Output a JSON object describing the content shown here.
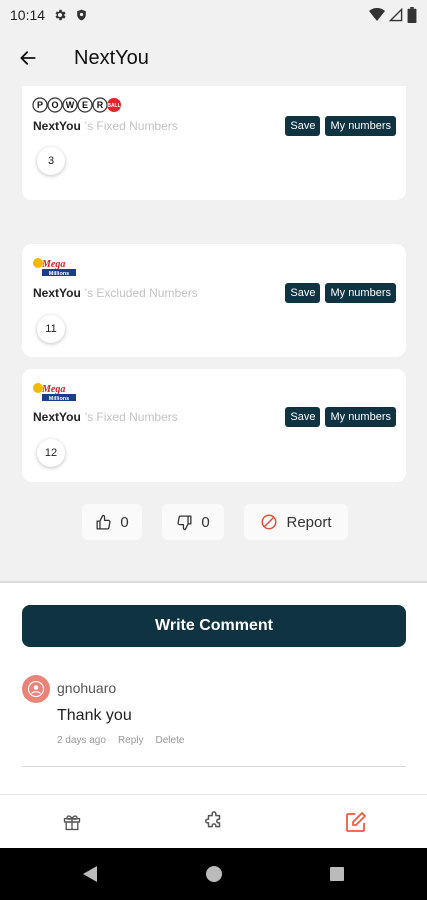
{
  "status_bar": {
    "time": "10:14"
  },
  "app_bar": {
    "title": "NextYou"
  },
  "cards": [
    {
      "logo": "powerball",
      "logo_text": "POWERBALL",
      "owner": "NextYou",
      "label": "'s Fixed Numbers",
      "save": "Save",
      "my_numbers": "My numbers",
      "ball": "3"
    },
    {
      "logo": "mega-millions",
      "logo_text": "Mega Millions",
      "owner": "NextYou",
      "label": "'s Excluded Numbers",
      "save": "Save",
      "my_numbers": "My numbers",
      "ball": "11"
    },
    {
      "logo": "mega-millions",
      "logo_text": "Mega Millions",
      "owner": "NextYou",
      "label": "'s Fixed Numbers",
      "save": "Save",
      "my_numbers": "My numbers",
      "ball": "12"
    }
  ],
  "reactions": {
    "likes": "0",
    "dislikes": "0",
    "report": "Report"
  },
  "comments": {
    "write_label": "Write Comment",
    "items": [
      {
        "user": "gnohuaro",
        "text": "Thank you",
        "time": "2 days ago",
        "reply": "Reply",
        "delete": "Delete"
      }
    ]
  },
  "bottom_nav": {
    "items": [
      {
        "icon": "gift-icon"
      },
      {
        "icon": "puzzle-icon"
      },
      {
        "icon": "edit-icon",
        "active": true
      }
    ]
  },
  "colors": {
    "accent": "#0f3340",
    "active": "#f05a3c",
    "report": "#e4503a"
  }
}
